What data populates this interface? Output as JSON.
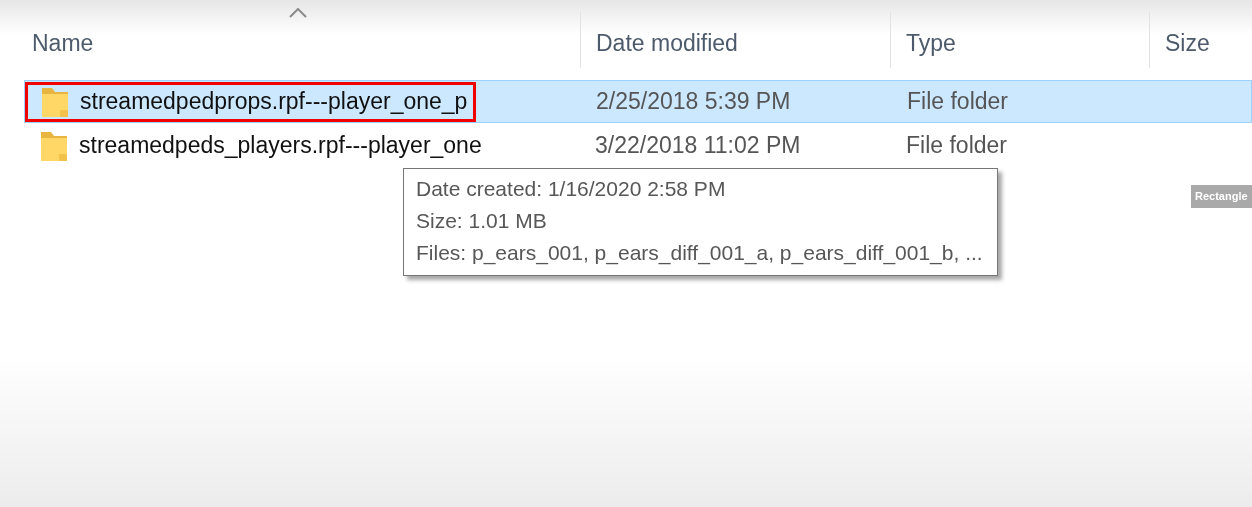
{
  "columns": [
    {
      "label": "Name",
      "sorted": true
    },
    {
      "label": "Date modified",
      "sorted": false
    },
    {
      "label": "Type",
      "sorted": false
    },
    {
      "label": "Size",
      "sorted": false
    }
  ],
  "rows": [
    {
      "name": "streamedpedprops.rpf---player_one_p",
      "date": "2/25/2018 5:39 PM",
      "type": "File folder",
      "selected": true,
      "outlined": true
    },
    {
      "name": "streamedpeds_players.rpf---player_one",
      "date": "3/22/2018 11:02 PM",
      "type": "File folder",
      "selected": false,
      "outlined": false
    }
  ],
  "tooltip": {
    "lines": [
      "Date created: 1/16/2020 2:58 PM",
      "Size: 1.01 MB",
      "Files: p_ears_001, p_ears_diff_001_a, p_ears_diff_001_b, ..."
    ]
  },
  "overlay_label": "Rectangle"
}
